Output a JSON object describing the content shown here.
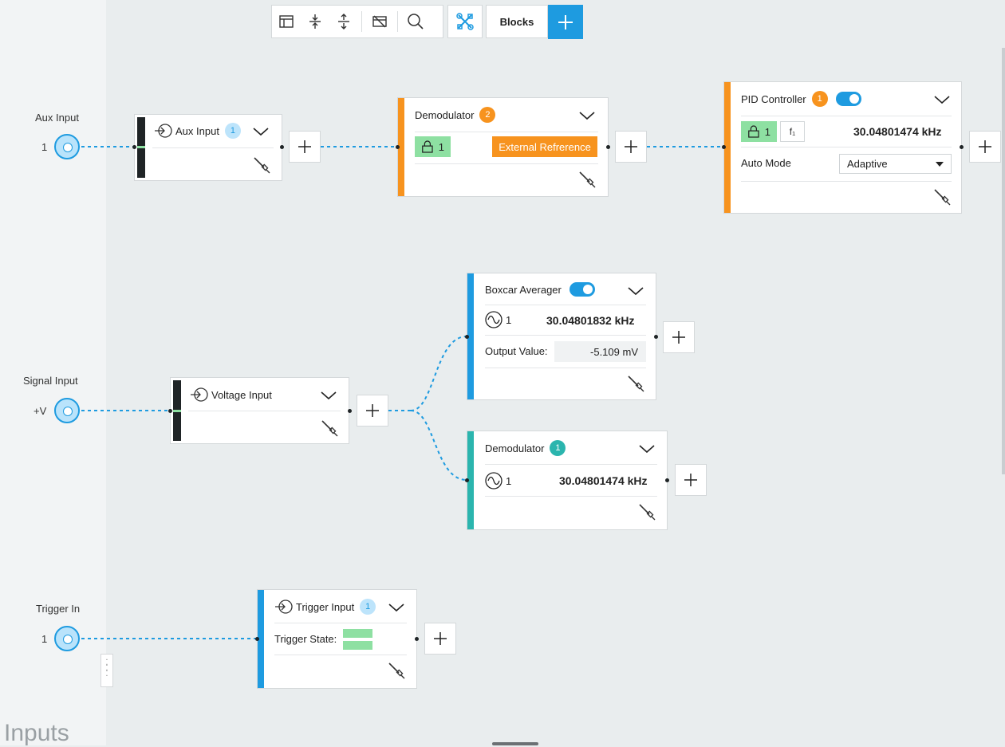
{
  "toolbar": {
    "layout_icon": "layout-icon",
    "collapse_icon": "collapse-vertical-icon",
    "expand_icon": "expand-vertical-icon",
    "hide_icon": "hide-panel-icon",
    "search_icon": "search-icon",
    "tools_icon": "tools-icon",
    "blocks_label": "Blocks",
    "add_icon": "plus-icon"
  },
  "inputs_panel": {
    "title": "Inputs",
    "ports": [
      {
        "label": "Aux Input",
        "number": "1"
      },
      {
        "label": "Signal Input",
        "number": "+V"
      },
      {
        "label": "Trigger In",
        "number": "1"
      }
    ]
  },
  "blocks": {
    "aux_input": {
      "title": "Aux Input",
      "badge": "1"
    },
    "demod_2": {
      "title": "Demodulator",
      "badge": "2",
      "lock": "1",
      "reference": "External Refrerence"
    },
    "pid": {
      "title": "PID Controller",
      "badge": "1",
      "enabled": true,
      "lock": "1",
      "f_label": "f₁",
      "frequency": "30.04801474 kHz",
      "mode_label": "Auto Mode",
      "mode_value": "Adaptive"
    },
    "voltage_input": {
      "title": "Voltage Input"
    },
    "boxcar": {
      "title": "Boxcar Averager",
      "enabled": true,
      "channel": "1",
      "frequency": "30.04801832 kHz",
      "output_label": "Output Value:",
      "output_value": "-5.109 mV"
    },
    "demod_1": {
      "title": "Demodulator",
      "badge": "1",
      "channel": "1",
      "frequency": "30.04801474 kHz"
    },
    "trigger_input": {
      "title": "Trigger Input",
      "badge": "1",
      "state_label": "Trigger State:"
    }
  },
  "colors": {
    "accent_blue": "#1e9be0",
    "accent_orange": "#f7931e",
    "accent_teal": "#2bb5ae",
    "lock_green": "#8ee0a2"
  }
}
